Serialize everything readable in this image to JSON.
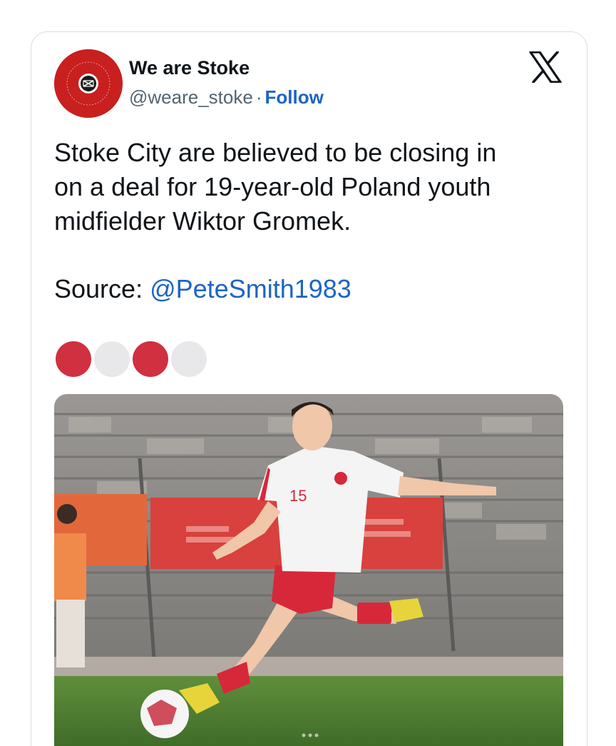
{
  "tweet": {
    "author": {
      "display_name": "We are Stoke",
      "handle": "@weare_stoke",
      "separator": "·",
      "follow_label": "Follow",
      "avatar_text": "WE ARE STOKE"
    },
    "platform_icon": "x-logo-icon",
    "body_lines": [
      "Stoke City are believed to be closing in",
      "on a deal for 19-year-old Poland youth",
      "midfielder Wiktor Gromek."
    ],
    "source_label": "Source:",
    "source_mention": "@PeteSmith1983",
    "emoji_circles": [
      "red",
      "white",
      "red",
      "white"
    ],
    "media": {
      "shirt_number": "15",
      "icon": "photo-footballer"
    }
  },
  "colors": {
    "link": "#1d64c4",
    "text": "#0f1419",
    "secondary": "#536471",
    "avatar_bg": "#c8201f",
    "poland_red": "#d0303f"
  }
}
